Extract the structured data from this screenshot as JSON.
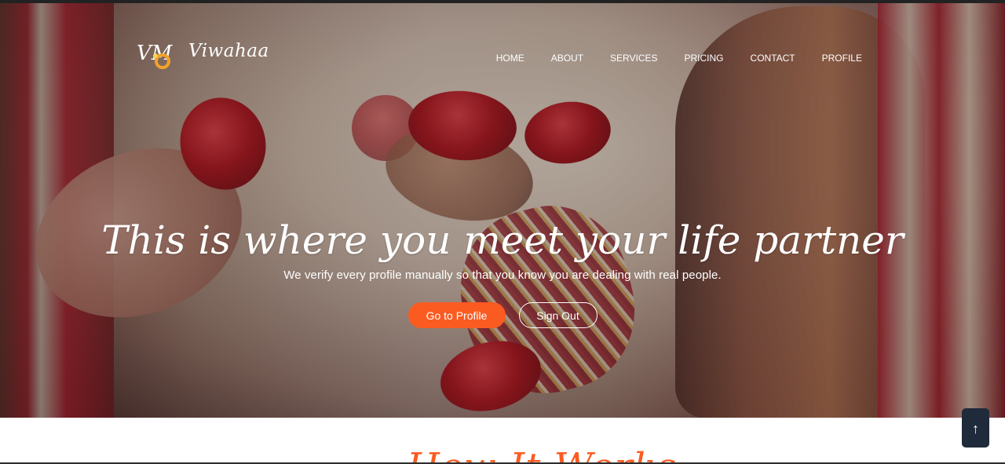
{
  "brand": {
    "name": "Viwahaa",
    "logo_letters": "VM"
  },
  "nav": {
    "items": [
      "HOME",
      "ABOUT",
      "SERVICES",
      "PRICING",
      "CONTACT",
      "PROFILE"
    ]
  },
  "hero": {
    "headline": "This is where you meet your life partner",
    "subtext": "We verify every profile manually so that you know you are dealing with real people.",
    "primary_button": "Go to Profile",
    "secondary_button": "Sign Out"
  },
  "next_section": {
    "visible_title_fragment": "How It Works"
  },
  "scroll_top": {
    "label": "↑",
    "icon": "arrow-up-icon"
  },
  "colors": {
    "accent": "#fb5b21",
    "scroll_button": "#1f2a3a",
    "text_on_hero": "#ffffff"
  }
}
